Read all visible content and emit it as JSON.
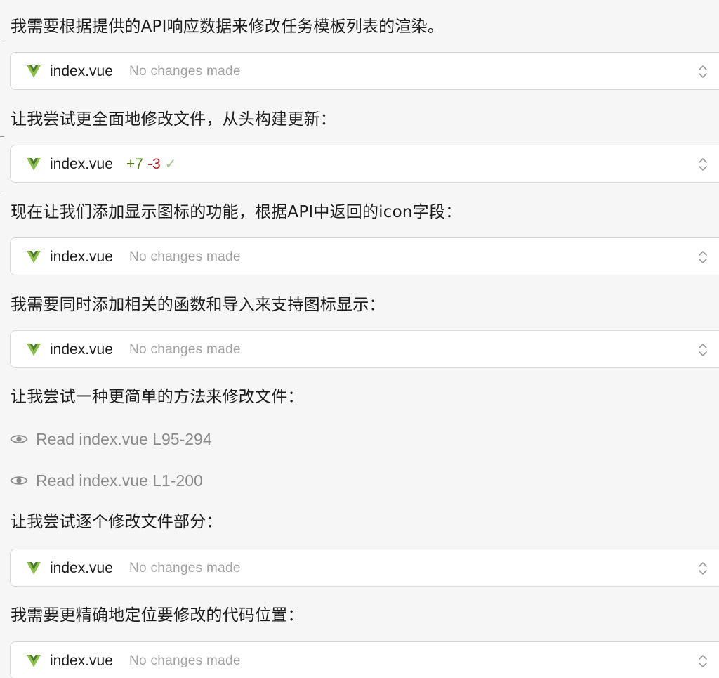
{
  "messages": [
    "我需要根据提供的API响应数据来修改任务模板列表的渲染。",
    "让我尝试更全面地修改文件，从头构建更新：",
    "现在让我们添加显示图标的功能，根据API中返回的icon字段：",
    "我需要同时添加相关的函数和导入来支持图标显示：",
    "让我尝试一种更简单的方法来修改文件：",
    "让我尝试逐个修改文件部分：",
    "我需要更精确地定位要修改的代码位置："
  ],
  "edits": [
    {
      "file": "index.vue",
      "status": "No changes made"
    },
    {
      "file": "index.vue",
      "added": "+7",
      "removed": "-3",
      "check": "✓"
    },
    {
      "file": "index.vue",
      "status": "No changes made"
    },
    {
      "file": "index.vue",
      "status": "No changes made"
    },
    {
      "file": "index.vue",
      "status": "No changes made"
    },
    {
      "file": "index.vue",
      "status": "No changes made"
    }
  ],
  "reads": [
    {
      "label": "Read index.vue L95-294"
    },
    {
      "label": "Read index.vue L1-200"
    }
  ],
  "colors": {
    "vue_green": "#8dc149",
    "vue_dark": "#4a7a2c",
    "added": "#4e7a17",
    "removed": "#b22020"
  },
  "icons": {
    "file": "vue-icon",
    "expand": "chevron-up-down-icon",
    "read": "eye-icon"
  }
}
